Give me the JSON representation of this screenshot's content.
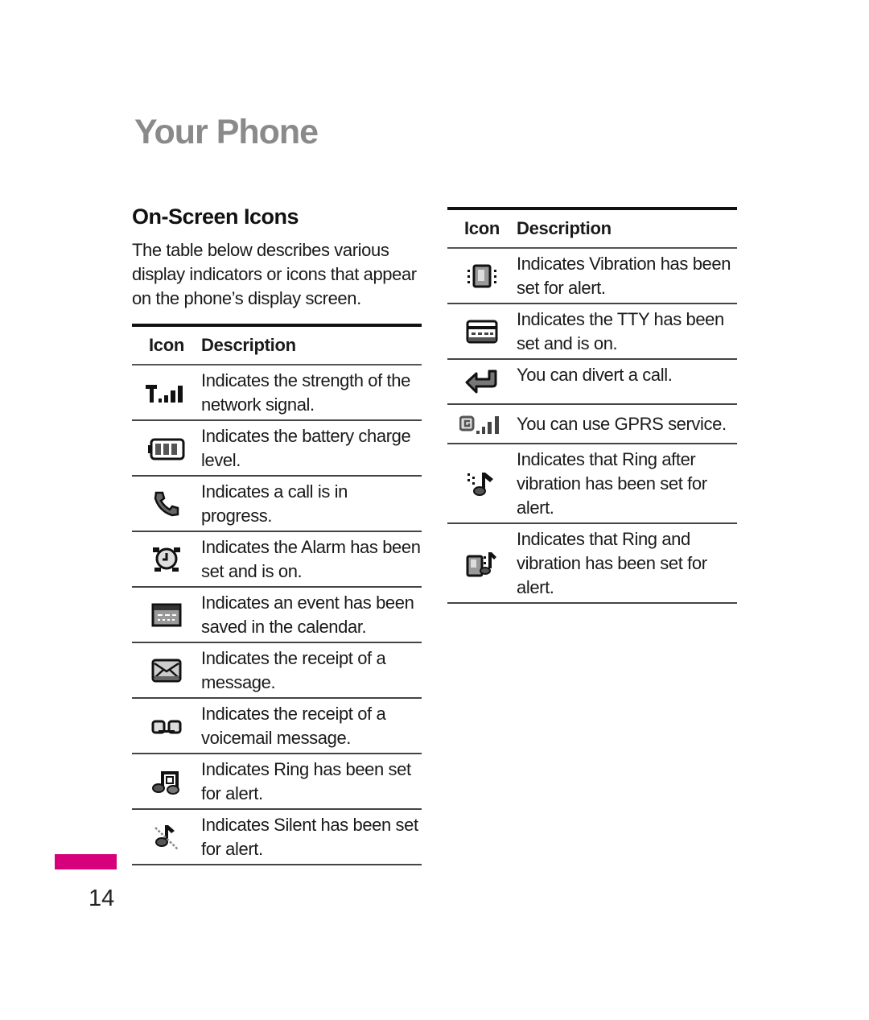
{
  "page": {
    "chapter_title": "Your Phone",
    "section_title": "On-Screen Icons",
    "intro": "The table below describes various display indicators or icons that appear on the phone’s display screen.",
    "page_number": "14",
    "accent_color": "#d6007a"
  },
  "table_headers": {
    "icon": "Icon",
    "description": "Description"
  },
  "left_table": [
    {
      "icon": "signal-strength-icon",
      "description": "Indicates the strength of the network signal."
    },
    {
      "icon": "battery-icon",
      "description": "Indicates the battery charge level."
    },
    {
      "icon": "call-in-progress-icon",
      "description": "Indicates a call is in progress."
    },
    {
      "icon": "alarm-clock-icon",
      "description": "Indicates the Alarm has been set and is on."
    },
    {
      "icon": "calendar-icon",
      "description": "Indicates an event has been saved in the calendar."
    },
    {
      "icon": "message-envelope-icon",
      "description": "Indicates the receipt of a message."
    },
    {
      "icon": "voicemail-icon",
      "description": "Indicates the receipt of a voicemail message."
    },
    {
      "icon": "ring-icon",
      "description": "Indicates Ring has been set for alert."
    },
    {
      "icon": "silent-icon",
      "description": "Indicates Silent has been set for alert."
    }
  ],
  "right_table": [
    {
      "icon": "vibration-icon",
      "description": "Indicates Vibration has been set for alert."
    },
    {
      "icon": "tty-icon",
      "description": "Indicates the TTY has been set and is on."
    },
    {
      "icon": "call-divert-icon",
      "description": "You can divert a call."
    },
    {
      "icon": "gprs-icon",
      "description": "You can use GPRS service."
    },
    {
      "icon": "ring-after-vibration-icon",
      "description": "Indicates that Ring after vibration has been set for alert."
    },
    {
      "icon": "ring-and-vibration-icon",
      "description": "Indicates that Ring and vibration has been set for alert."
    }
  ]
}
